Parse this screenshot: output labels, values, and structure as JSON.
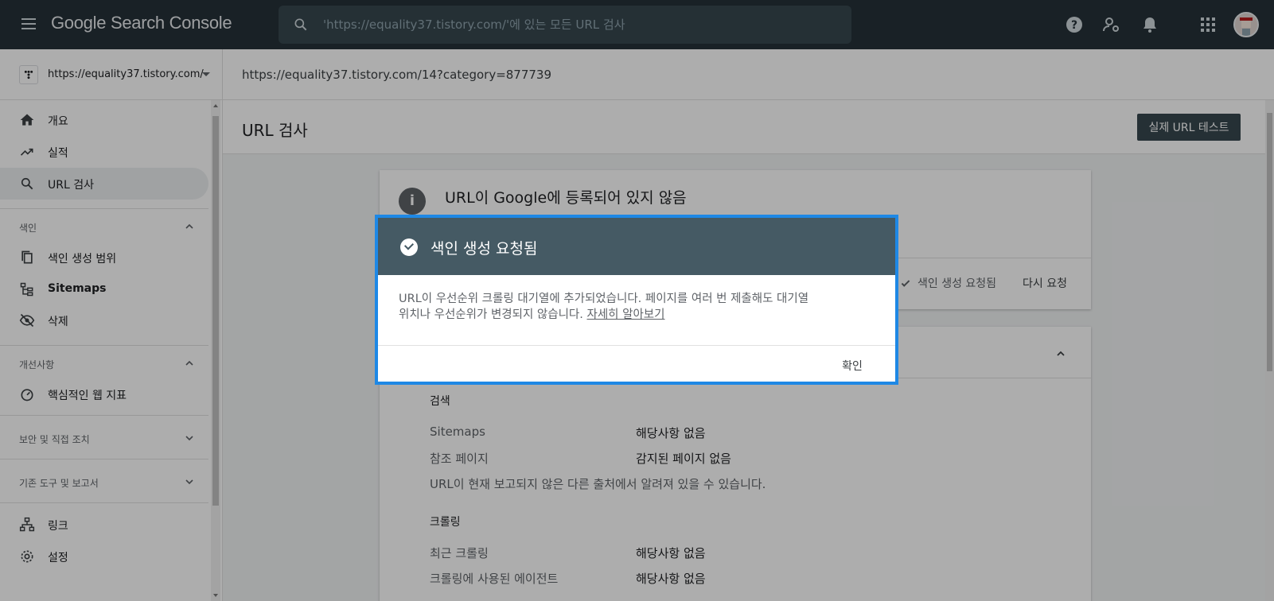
{
  "app": {
    "brand": "Google Search Console"
  },
  "search": {
    "placeholder": "'https://equality37.tistory.com/'에 있는 모든 URL 검사"
  },
  "property": {
    "url": "https://equality37.tistory.com/"
  },
  "inspected_url": "https://equality37.tistory.com/14?category=877739",
  "sidebar": {
    "items": [
      {
        "label": "개요",
        "icon": "home-icon"
      },
      {
        "label": "실적",
        "icon": "trending-up-icon"
      },
      {
        "label": "URL 검사",
        "icon": "search-icon",
        "active": true
      }
    ],
    "index_section": {
      "label": "색인",
      "items": [
        {
          "label": "색인 생성 범위",
          "icon": "copy-icon"
        },
        {
          "label": "Sitemaps",
          "icon": "sitemap-icon"
        },
        {
          "label": "삭제",
          "icon": "eye-off-icon"
        }
      ]
    },
    "enhancements_section": {
      "label": "개선사항",
      "items": [
        {
          "label": "핵심적인 웹 지표",
          "icon": "gauge-icon"
        }
      ]
    },
    "security_section": {
      "label": "보안 및 직접 조치"
    },
    "legacy_section": {
      "label": "기존 도구 및 보고서"
    },
    "bottom_items": [
      {
        "label": "링크",
        "icon": "links-icon"
      },
      {
        "label": "설정",
        "icon": "settings-icon"
      }
    ]
  },
  "main": {
    "title": "URL 검사",
    "test_button": "실제 URL 테스트",
    "status_heading": "URL이 Google에 등록되어 있지 않음",
    "requested_label": "색인 생성 요청됨",
    "request_again": "다시 요청",
    "details": {
      "search_section": "검색",
      "rows": [
        {
          "label": "Sitemaps",
          "value": "해당사항 없음"
        },
        {
          "label": "참조 페이지",
          "value": "감지된 페이지 없음"
        }
      ],
      "note": "URL이 현재 보고되지 않은 다른 출처에서 알려져 있을 수 있습니다.",
      "crawl_section": "크롤링",
      "crawl_rows": [
        {
          "label": "최근 크롤링",
          "value": "해당사항 없음"
        },
        {
          "label": "크롤링에 사용된 에이전트",
          "value": "해당사항 없음"
        }
      ]
    }
  },
  "dialog": {
    "title": "색인 생성 요청됨",
    "body_line1": "URL이 우선순위 크롤링 대기열에 추가되었습니다. 페이지를 여러 번 제출해도 대기열",
    "body_line2": "위치나 우선순위가 변경되지 않습니다. ",
    "learn_more": "자세히 알아보기",
    "ok": "확인"
  },
  "colors": {
    "topbar": "#263238",
    "dialog_header": "#455a64",
    "dialog_outline": "#1e88e5",
    "button_dark": "#37474f"
  }
}
